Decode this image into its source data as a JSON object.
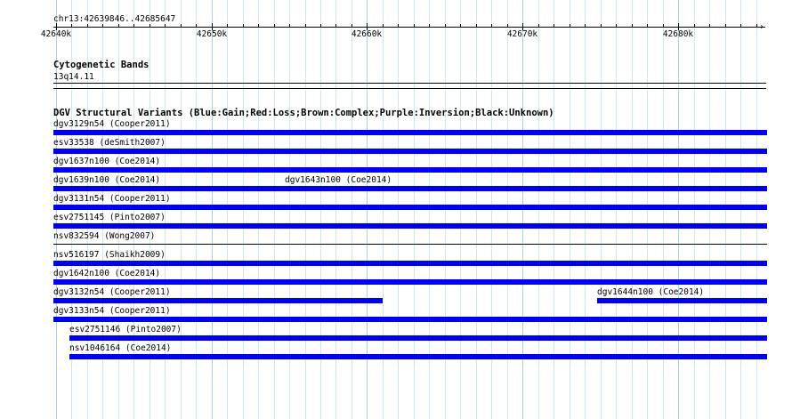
{
  "ruler": {
    "location_label": "chr13:42639846..42685647",
    "ticks": [
      {
        "label": "42640k",
        "bp": 42640000
      },
      {
        "label": "42650k",
        "bp": 42650000
      },
      {
        "label": "42660k",
        "bp": 42660000
      },
      {
        "label": "42670k",
        "bp": 42670000
      },
      {
        "label": "42680k",
        "bp": 42680000
      }
    ]
  },
  "cytoband_track": {
    "title": "Cytogenetic Bands",
    "band_label": "13q14.11"
  },
  "dgv_track": {
    "title": "DGV Structural Variants (Blue:Gain;Red:Loss;Brown:Complex;Purple:Inversion;Black:Unknown)",
    "colors": {
      "gain": "#0000ee",
      "unknown": "#000000"
    },
    "rows": [
      {
        "features": [
          {
            "label": "dgv3129n54 (Cooper2011)",
            "type": "gain",
            "start": 42639846,
            "end": 42685647
          }
        ]
      },
      {
        "features": [
          {
            "label": "esv33538 (deSmith2007)",
            "type": "gain",
            "start": 42639846,
            "end": 42685647
          }
        ]
      },
      {
        "features": [
          {
            "label": "dgv1637n100 (Coe2014)",
            "type": "gain",
            "start": 42639846,
            "end": 42685647
          }
        ]
      },
      {
        "features": [
          {
            "label": "dgv1639n100 (Coe2014)",
            "type": "gain",
            "start": 42639846,
            "end": 42685647
          },
          {
            "label": "dgv1643n100 (Coe2014)",
            "type": "gain",
            "start": 42654700,
            "end": 42685647
          }
        ]
      },
      {
        "features": [
          {
            "label": "dgv3131n54 (Cooper2011)",
            "type": "gain",
            "start": 42639846,
            "end": 42685647
          }
        ]
      },
      {
        "features": [
          {
            "label": "esv2751145 (Pinto2007)",
            "type": "gain",
            "start": 42639846,
            "end": 42685647
          }
        ]
      },
      {
        "features": [
          {
            "label": "nsv832594 (Wong2007)",
            "type": "unknown",
            "start": 42639846,
            "end": 42685647
          }
        ]
      },
      {
        "features": [
          {
            "label": "nsv516197 (Shaikh2009)",
            "type": "gain",
            "start": 42639846,
            "end": 42685647
          }
        ]
      },
      {
        "features": [
          {
            "label": "dgv1642n100 (Coe2014)",
            "type": "gain",
            "start": 42639846,
            "end": 42685647
          }
        ]
      },
      {
        "features": [
          {
            "label": "dgv3132n54 (Cooper2011)",
            "type": "gain",
            "start": 42639846,
            "end": 42661000
          },
          {
            "label": "dgv1644n100 (Coe2014)",
            "type": "gain",
            "start": 42674800,
            "end": 42685647
          }
        ]
      },
      {
        "features": [
          {
            "label": "dgv3133n54 (Cooper2011)",
            "type": "gain",
            "start": 42639846,
            "end": 42685647
          }
        ]
      },
      {
        "features": [
          {
            "label": "esv2751146 (Pinto2007)",
            "type": "gain",
            "start": 42640850,
            "end": 42685647
          }
        ]
      },
      {
        "features": [
          {
            "label": "nsv1046164 (Coe2014)",
            "type": "gain",
            "start": 42640850,
            "end": 42685647
          }
        ]
      }
    ]
  }
}
